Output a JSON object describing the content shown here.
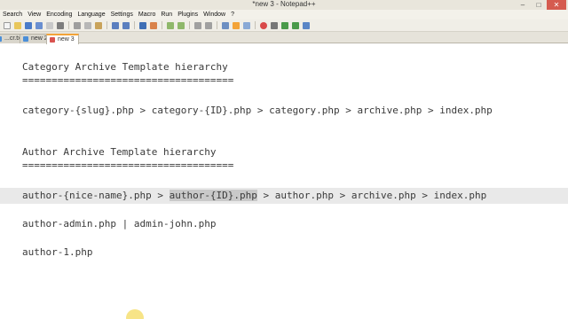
{
  "window": {
    "title": "*new  3 - Notepad++",
    "minimize": "–",
    "maximize": "□",
    "close": "✕"
  },
  "menu": [
    "Search",
    "View",
    "Encoding",
    "Language",
    "Settings",
    "Macro",
    "Run",
    "Plugins",
    "Window",
    "?"
  ],
  "toolbar_icons": [
    "new-file-icon",
    "open-file-icon",
    "save-icon",
    "save-all-icon",
    "close-icon",
    "print-icon",
    "cut-icon",
    "copy-icon",
    "paste-icon",
    "undo-icon",
    "redo-icon",
    "find-icon",
    "replace-icon",
    "zoom-in-icon",
    "zoom-out-icon",
    "sync-v-icon",
    "sync-h-icon",
    "word-wrap-icon",
    "show-all-icon",
    "indent-guide-icon",
    "record-macro-icon",
    "stop-macro-icon",
    "play-macro-icon",
    "run-macro-icon",
    "save-macro-icon"
  ],
  "tabs": [
    {
      "label": "...cr.txt",
      "state": "saved"
    },
    {
      "label": "new 2",
      "state": "saved"
    },
    {
      "label": "new 3",
      "state": "unsaved-active"
    }
  ],
  "editor": {
    "lines": {
      "category_heading": "Category Archive Template hierarchy",
      "category_rule": "====================================",
      "category_chain": "category-{slug}.php > category-{ID}.php > category.php > archive.php > index.php",
      "author_heading": "Author Archive Template hierarchy",
      "author_rule": "====================================",
      "author_chain_before": "author-{nice-name}.php > ",
      "author_chain_selected": "author-{ID}.php",
      "author_chain_after": " > author.php > archive.php > index.php",
      "author_admin": "author-admin.php | admin-john.php",
      "author_one": "author-1.php"
    }
  },
  "colors": {
    "tab_accent": "#f3a338",
    "unsaved_icon": "#d9534f",
    "saved_icon": "#4a8ed8",
    "current_line": "#e9e9e9",
    "selection": "#c9c9c9"
  }
}
